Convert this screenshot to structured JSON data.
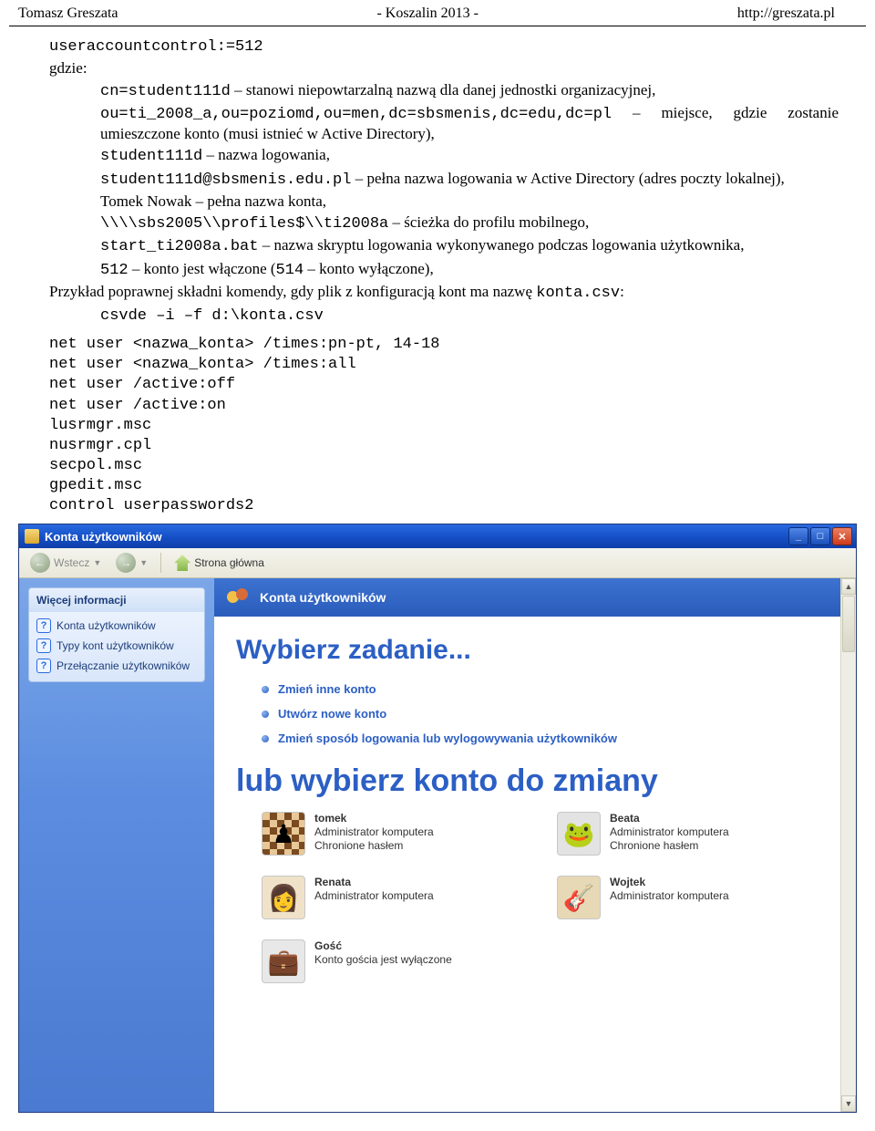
{
  "header": {
    "left": "Tomasz Greszata",
    "center": "- Koszalin 2013 -",
    "right": "http://greszata.pl"
  },
  "doc": {
    "l1": "useraccountcontrol:=512",
    "l2": "gdzie:",
    "l3a": "cn=student111d",
    "l3b": " – stanowi niepowtarzalną nazwą dla danej jednostki organizacyjnej,",
    "l4a": "ou=ti_2008_a,ou=poziomd,ou=men,dc=sbsmenis,dc=edu,dc=pl",
    "l4b": " – miejsce, gdzie zostanie umieszczone konto (musi istnieć w Active Directory),",
    "l5a": "student111d",
    "l5b": " – nazwa logowania,",
    "l6a": "student111d@sbsmenis.edu.pl",
    "l6b": " – pełna nazwa logowania w Active Directory (adres poczty lokalnej),",
    "l7": "Tomek Nowak – pełna nazwa konta,",
    "l8a": "\\\\\\\\sbs2005\\\\profiles$\\\\ti2008a",
    "l8b": " – ścieżka do profilu mobilnego,",
    "l9a": "start_ti2008a.bat",
    "l9b": " – nazwa skryptu logowania wykonywanego podczas logowania użytkownika,",
    "l10a": "512",
    "l10b": " – konto jest włączone (",
    "l10c": "514",
    "l10d": " – konto wyłączone),",
    "l11a": "Przykład poprawnej składni komendy, gdy plik z konfiguracją kont ma nazwę ",
    "l11b": "konta.csv",
    "l11c": ":",
    "l12": "csvde –i –f d:\\konta.csv"
  },
  "cmds": [
    "net user <nazwa_konta> /times:pn-pt, 14-18",
    "net user <nazwa_konta> /times:all",
    "net user /active:off",
    "net user /active:on",
    "lusrmgr.msc",
    "nusrmgr.cpl",
    "secpol.msc",
    "gpedit.msc",
    "control userpasswords2"
  ],
  "window": {
    "title": "Konta użytkowników",
    "toolbar": {
      "back": "Wstecz",
      "home": "Strona główna"
    },
    "sidebar": {
      "card_title": "Więcej informacji",
      "links": [
        "Konta użytkowników",
        "Typy kont użytkowników",
        "Przełączanie użytkowników"
      ]
    },
    "banner": "Konta użytkowników",
    "heading1": "Wybierz zadanie...",
    "tasks": [
      "Zmień inne konto",
      "Utwórz nowe konto",
      "Zmień sposób logowania lub wylogowywania użytkowników"
    ],
    "heading2": "lub wybierz konto do zmiany",
    "users": [
      {
        "name": "tomek",
        "role": "Administrator komputera",
        "note": "Chronione hasłem",
        "avatar": "♟"
      },
      {
        "name": "Beata",
        "role": "Administrator komputera",
        "note": "Chronione hasłem",
        "avatar": "🐸"
      },
      {
        "name": "Renata",
        "role": "Administrator komputera",
        "note": "",
        "avatar": "👩"
      },
      {
        "name": "Wojtek",
        "role": "Administrator komputera",
        "note": "",
        "avatar": "🎸"
      },
      {
        "name": "Gość",
        "role": "Konto gościa jest wyłączone",
        "note": "",
        "avatar": "💼"
      }
    ]
  }
}
